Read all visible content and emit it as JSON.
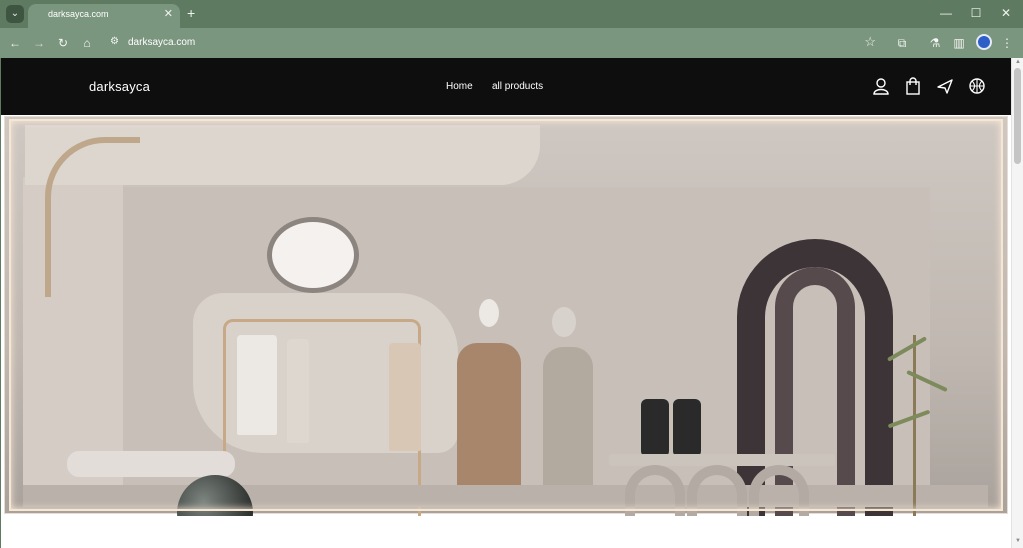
{
  "browser": {
    "tab": {
      "title": "darksayca.com"
    },
    "url": "darksayca.com",
    "icons": {
      "tab_menu": "chevron-down-icon",
      "new_tab": "plus-icon",
      "back": "arrow-left-icon",
      "forward": "arrow-right-icon",
      "reload": "reload-icon",
      "home": "home-icon",
      "site_info": "tune-icon",
      "bookmark": "star-icon",
      "extensions": "puzzle-icon",
      "labs": "flask-icon",
      "sidebar": "sidebar-icon",
      "profile": "profile-icon",
      "menu": "kebab-icon"
    },
    "window_controls": {
      "minimize": "minimize-icon",
      "maximize": "maximize-icon",
      "close": "close-icon"
    },
    "colors": {
      "frame": "#5e7b62",
      "toolbar": "#7b967e",
      "profile_accent": "#2e5fc9"
    }
  },
  "site": {
    "logo": "darksayca",
    "nav": [
      {
        "label": "Home"
      },
      {
        "label": "all products"
      }
    ],
    "header_icons": [
      "user-icon",
      "shopping-bag-icon",
      "airplane-icon",
      "basketball-icon"
    ],
    "colors": {
      "header_bg": "#0e0e0e",
      "header_text": "#ffffff"
    }
  },
  "hero": {
    "image": "boutique-interior-icon"
  }
}
